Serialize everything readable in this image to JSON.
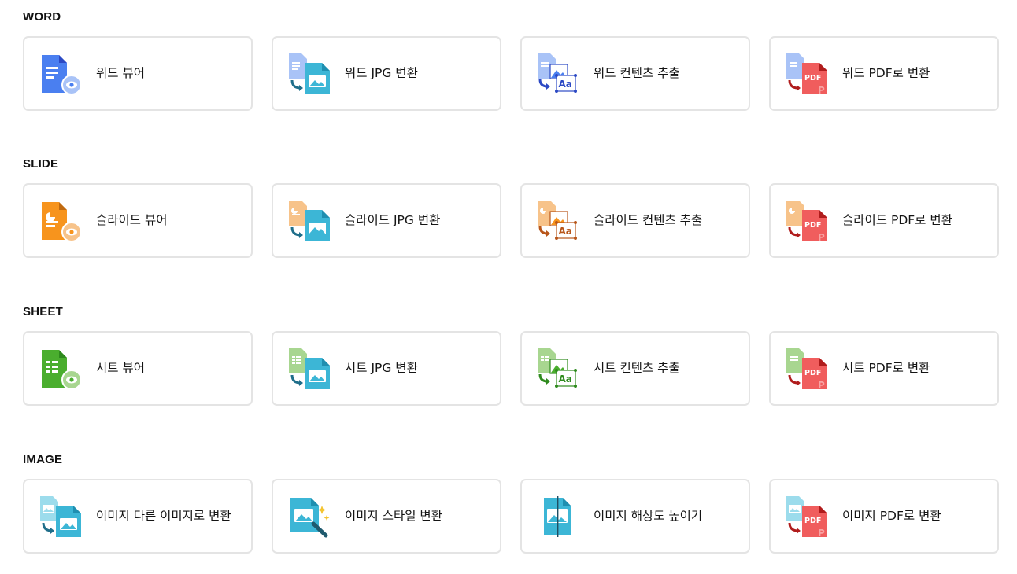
{
  "sections": [
    {
      "title": "WORD",
      "items": [
        {
          "label": "워드 뷰어",
          "icon": "word-viewer-icon"
        },
        {
          "label": "워드 JPG 변환",
          "icon": "word-to-jpg-icon"
        },
        {
          "label": "워드 컨텐츠 추출",
          "icon": "word-content-extract-icon"
        },
        {
          "label": "워드 PDF로 변환",
          "icon": "word-to-pdf-icon"
        }
      ]
    },
    {
      "title": "SLIDE",
      "items": [
        {
          "label": "슬라이드 뷰어",
          "icon": "slide-viewer-icon"
        },
        {
          "label": "슬라이드 JPG 변환",
          "icon": "slide-to-jpg-icon"
        },
        {
          "label": "슬라이드 컨텐츠 추출",
          "icon": "slide-content-extract-icon"
        },
        {
          "label": "슬라이드 PDF로 변환",
          "icon": "slide-to-pdf-icon"
        }
      ]
    },
    {
      "title": "SHEET",
      "items": [
        {
          "label": "시트 뷰어",
          "icon": "sheet-viewer-icon"
        },
        {
          "label": "시트 JPG 변환",
          "icon": "sheet-to-jpg-icon"
        },
        {
          "label": "시트 컨텐츠 추출",
          "icon": "sheet-content-extract-icon"
        },
        {
          "label": "시트 PDF로 변환",
          "icon": "sheet-to-pdf-icon"
        }
      ]
    },
    {
      "title": "IMAGE",
      "items": [
        {
          "label": "이미지 다른 이미지로 변환",
          "icon": "image-convert-icon"
        },
        {
          "label": "이미지 스타일 변환",
          "icon": "image-style-icon"
        },
        {
          "label": "이미지 해상도 높이기",
          "icon": "image-upscale-icon"
        },
        {
          "label": "이미지 PDF로 변환",
          "icon": "image-to-pdf-icon"
        }
      ]
    }
  ],
  "colors": {
    "word": "#4a7ff0",
    "word_light": "#a9c3f7",
    "word_dark": "#2c49c4",
    "slide": "#f7941d",
    "slide_light": "#f7c38a",
    "slide_dark": "#b8561a",
    "sheet": "#4aae2e",
    "sheet_light": "#a8d690",
    "sheet_dark": "#2e8a1d",
    "image": "#3cb6d6",
    "image_light": "#9cdcec",
    "pdf": "#f05d5d",
    "pdf_dark": "#b01c1c",
    "border": "#e4e4e4"
  }
}
